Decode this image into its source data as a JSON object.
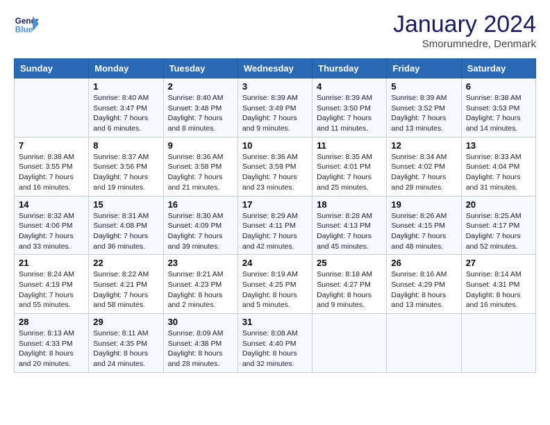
{
  "header": {
    "logo_line1": "General",
    "logo_line2": "Blue",
    "month_title": "January 2024",
    "location": "Smorumnedre, Denmark"
  },
  "days_of_week": [
    "Sunday",
    "Monday",
    "Tuesday",
    "Wednesday",
    "Thursday",
    "Friday",
    "Saturday"
  ],
  "weeks": [
    [
      {
        "day": null,
        "info": null
      },
      {
        "day": "1",
        "info": "Sunrise: 8:40 AM\nSunset: 3:47 PM\nDaylight: 7 hours\nand 6 minutes."
      },
      {
        "day": "2",
        "info": "Sunrise: 8:40 AM\nSunset: 3:48 PM\nDaylight: 7 hours\nand 8 minutes."
      },
      {
        "day": "3",
        "info": "Sunrise: 8:39 AM\nSunset: 3:49 PM\nDaylight: 7 hours\nand 9 minutes."
      },
      {
        "day": "4",
        "info": "Sunrise: 8:39 AM\nSunset: 3:50 PM\nDaylight: 7 hours\nand 11 minutes."
      },
      {
        "day": "5",
        "info": "Sunrise: 8:39 AM\nSunset: 3:52 PM\nDaylight: 7 hours\nand 13 minutes."
      },
      {
        "day": "6",
        "info": "Sunrise: 8:38 AM\nSunset: 3:53 PM\nDaylight: 7 hours\nand 14 minutes."
      }
    ],
    [
      {
        "day": "7",
        "info": "Sunrise: 8:38 AM\nSunset: 3:55 PM\nDaylight: 7 hours\nand 16 minutes."
      },
      {
        "day": "8",
        "info": "Sunrise: 8:37 AM\nSunset: 3:56 PM\nDaylight: 7 hours\nand 19 minutes."
      },
      {
        "day": "9",
        "info": "Sunrise: 8:36 AM\nSunset: 3:58 PM\nDaylight: 7 hours\nand 21 minutes."
      },
      {
        "day": "10",
        "info": "Sunrise: 8:36 AM\nSunset: 3:59 PM\nDaylight: 7 hours\nand 23 minutes."
      },
      {
        "day": "11",
        "info": "Sunrise: 8:35 AM\nSunset: 4:01 PM\nDaylight: 7 hours\nand 25 minutes."
      },
      {
        "day": "12",
        "info": "Sunrise: 8:34 AM\nSunset: 4:02 PM\nDaylight: 7 hours\nand 28 minutes."
      },
      {
        "day": "13",
        "info": "Sunrise: 8:33 AM\nSunset: 4:04 PM\nDaylight: 7 hours\nand 31 minutes."
      }
    ],
    [
      {
        "day": "14",
        "info": "Sunrise: 8:32 AM\nSunset: 4:06 PM\nDaylight: 7 hours\nand 33 minutes."
      },
      {
        "day": "15",
        "info": "Sunrise: 8:31 AM\nSunset: 4:08 PM\nDaylight: 7 hours\nand 36 minutes."
      },
      {
        "day": "16",
        "info": "Sunrise: 8:30 AM\nSunset: 4:09 PM\nDaylight: 7 hours\nand 39 minutes."
      },
      {
        "day": "17",
        "info": "Sunrise: 8:29 AM\nSunset: 4:11 PM\nDaylight: 7 hours\nand 42 minutes."
      },
      {
        "day": "18",
        "info": "Sunrise: 8:28 AM\nSunset: 4:13 PM\nDaylight: 7 hours\nand 45 minutes."
      },
      {
        "day": "19",
        "info": "Sunrise: 8:26 AM\nSunset: 4:15 PM\nDaylight: 7 hours\nand 48 minutes."
      },
      {
        "day": "20",
        "info": "Sunrise: 8:25 AM\nSunset: 4:17 PM\nDaylight: 7 hours\nand 52 minutes."
      }
    ],
    [
      {
        "day": "21",
        "info": "Sunrise: 8:24 AM\nSunset: 4:19 PM\nDaylight: 7 hours\nand 55 minutes."
      },
      {
        "day": "22",
        "info": "Sunrise: 8:22 AM\nSunset: 4:21 PM\nDaylight: 7 hours\nand 58 minutes."
      },
      {
        "day": "23",
        "info": "Sunrise: 8:21 AM\nSunset: 4:23 PM\nDaylight: 8 hours\nand 2 minutes."
      },
      {
        "day": "24",
        "info": "Sunrise: 8:19 AM\nSunset: 4:25 PM\nDaylight: 8 hours\nand 5 minutes."
      },
      {
        "day": "25",
        "info": "Sunrise: 8:18 AM\nSunset: 4:27 PM\nDaylight: 8 hours\nand 9 minutes."
      },
      {
        "day": "26",
        "info": "Sunrise: 8:16 AM\nSunset: 4:29 PM\nDaylight: 8 hours\nand 13 minutes."
      },
      {
        "day": "27",
        "info": "Sunrise: 8:14 AM\nSunset: 4:31 PM\nDaylight: 8 hours\nand 16 minutes."
      }
    ],
    [
      {
        "day": "28",
        "info": "Sunrise: 8:13 AM\nSunset: 4:33 PM\nDaylight: 8 hours\nand 20 minutes."
      },
      {
        "day": "29",
        "info": "Sunrise: 8:11 AM\nSunset: 4:35 PM\nDaylight: 8 hours\nand 24 minutes."
      },
      {
        "day": "30",
        "info": "Sunrise: 8:09 AM\nSunset: 4:38 PM\nDaylight: 8 hours\nand 28 minutes."
      },
      {
        "day": "31",
        "info": "Sunrise: 8:08 AM\nSunset: 4:40 PM\nDaylight: 8 hours\nand 32 minutes."
      },
      {
        "day": null,
        "info": null
      },
      {
        "day": null,
        "info": null
      },
      {
        "day": null,
        "info": null
      }
    ]
  ]
}
